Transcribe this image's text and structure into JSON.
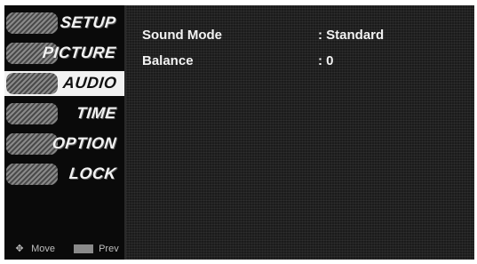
{
  "menu": {
    "items": [
      {
        "label": "SETUP",
        "icon": "setup-thumbnail"
      },
      {
        "label": "PICTURE",
        "icon": "picture-thumbnail"
      },
      {
        "label": "AUDIO",
        "icon": "audio-thumbnail",
        "active": true
      },
      {
        "label": "TIME",
        "icon": "time-thumbnail"
      },
      {
        "label": "OPTION",
        "icon": "option-thumbnail"
      },
      {
        "label": "LOCK",
        "icon": "lock-thumbnail"
      }
    ]
  },
  "hints": {
    "move": "Move",
    "prev": "Prev"
  },
  "settings": [
    {
      "name": "Sound Mode",
      "value": ": Standard"
    },
    {
      "name": "Balance",
      "value": ": 0"
    }
  ]
}
